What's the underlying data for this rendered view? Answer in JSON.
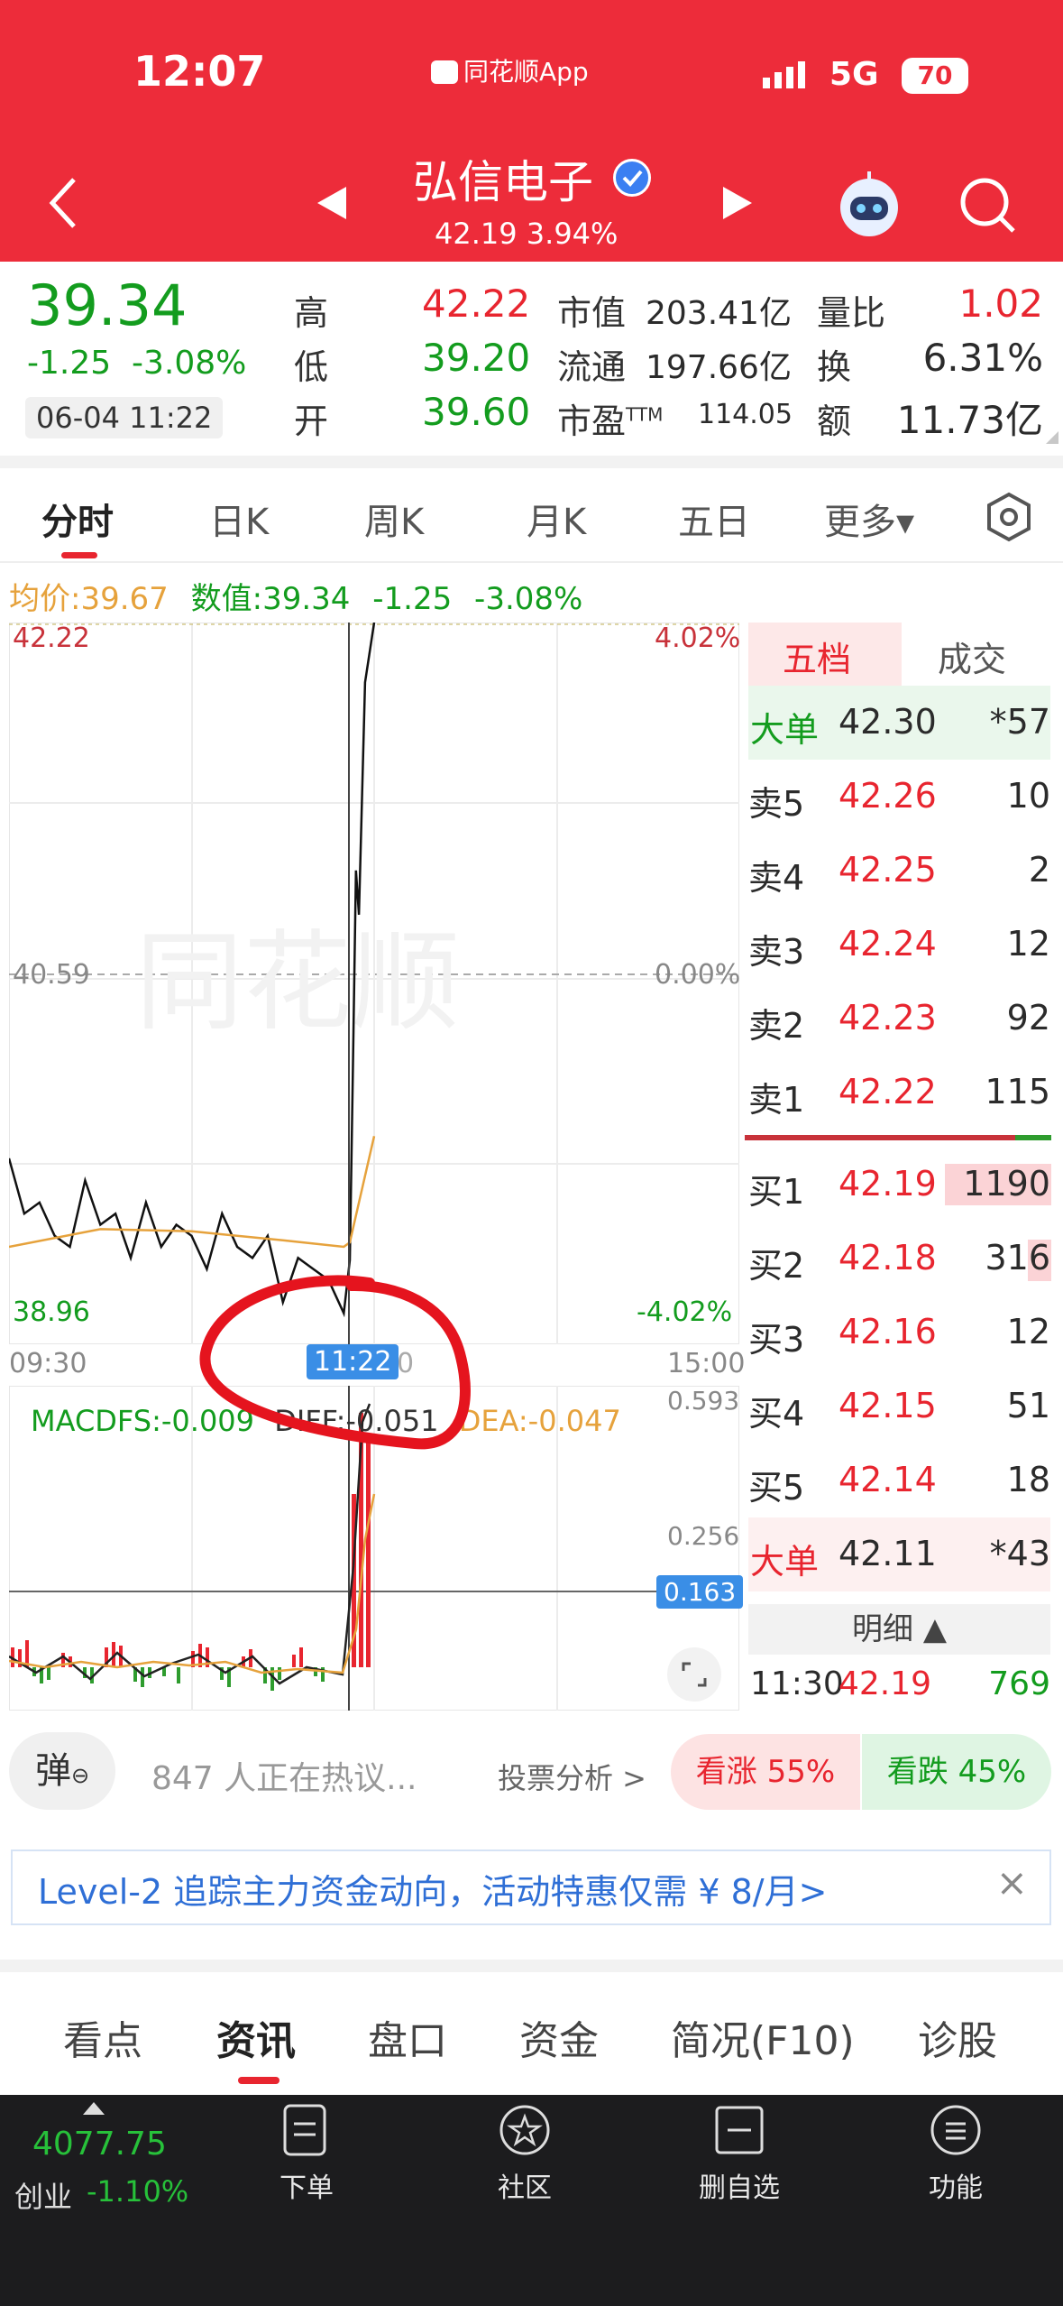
{
  "status_bar": {
    "time": "12:07",
    "app_label": "同花顺App",
    "network": "5G",
    "battery": "70"
  },
  "header": {
    "title": "弘信电子",
    "subtitle": "42.19 3.94%"
  },
  "quote": {
    "price": "39.34",
    "change": "-1.25",
    "change_pct": "-3.08%",
    "datetime": "06-04 11:22",
    "high_label": "高",
    "high": "42.22",
    "low_label": "低",
    "low": "39.20",
    "open_label": "开",
    "open": "39.60",
    "mktcap_label": "市值",
    "mktcap": "203.41亿",
    "float_label": "流通",
    "float": "197.66亿",
    "pe_label": "市盈",
    "pe_sup": "TTM",
    "pe": "114.05",
    "volratio_label": "量比",
    "volratio": "1.02",
    "turnover_label": "换",
    "turnover": "6.31%",
    "amount_label": "额",
    "amount": "11.73亿"
  },
  "chart_tabs": [
    "分时",
    "日K",
    "周K",
    "月K",
    "五日",
    "更多▾"
  ],
  "info_line": {
    "avg_label": "均价:",
    "avg": "39.67",
    "val_label": "数值:",
    "val": "39.34",
    "chg": "-1.25",
    "chg_pct": "-3.08%"
  },
  "chart_labels": {
    "y_top": "42.22",
    "y_mid": "40.59",
    "y_bot": "38.96",
    "pct_top": "4.02%",
    "pct_mid": "0.00%",
    "pct_bot": "-4.02%",
    "x_start": "09:30",
    "x_cursor": "11:22",
    "x_end": "15:00",
    "watermark": "同花顺"
  },
  "macd": {
    "macdfs": "MACDFS:-0.009",
    "diff": "DIFF:-0.051",
    "dea": "DEA:-0.047",
    "y_top": "0.593",
    "y_mid": "0.256",
    "cursor_val": "0.163"
  },
  "chart_data": {
    "type": "line",
    "title": "",
    "x_range": [
      "09:30",
      "15:00"
    ],
    "ylim": [
      38.96,
      42.22
    ],
    "series": [
      {
        "name": "价格",
        "x": [
          "09:30",
          "09:35",
          "09:40",
          "09:45",
          "09:50",
          "09:55",
          "10:00",
          "10:05",
          "10:10",
          "10:15",
          "10:20",
          "10:25",
          "10:30",
          "10:35",
          "10:40",
          "10:45",
          "10:50",
          "10:55",
          "11:00",
          "11:05",
          "11:10",
          "11:15",
          "11:20",
          "11:22",
          "11:23",
          "11:24",
          "11:25",
          "11:27",
          "11:30"
        ],
        "values": [
          39.8,
          39.55,
          39.6,
          39.45,
          39.4,
          39.7,
          39.5,
          39.55,
          39.35,
          39.6,
          39.4,
          39.5,
          39.45,
          39.3,
          39.55,
          39.4,
          39.35,
          39.45,
          39.15,
          39.35,
          39.3,
          39.25,
          39.1,
          39.34,
          40.2,
          41.1,
          40.9,
          41.95,
          42.22
        ]
      },
      {
        "name": "均价",
        "x": [
          "09:30",
          "10:00",
          "10:30",
          "11:00",
          "11:20",
          "11:22",
          "11:25",
          "11:30"
        ],
        "values": [
          39.4,
          39.48,
          39.47,
          39.43,
          39.4,
          39.42,
          39.6,
          39.9
        ]
      }
    ]
  },
  "orderbook": {
    "tab_five": "五档",
    "tab_trade": "成交",
    "big_top": {
      "label": "大单",
      "price": "42.30",
      "vol": "*57"
    },
    "asks": [
      {
        "label": "卖5",
        "price": "42.26",
        "vol": "10"
      },
      {
        "label": "卖4",
        "price": "42.25",
        "vol": "2"
      },
      {
        "label": "卖3",
        "price": "42.24",
        "vol": "12"
      },
      {
        "label": "卖2",
        "price": "42.23",
        "vol": "92"
      },
      {
        "label": "卖1",
        "price": "42.22",
        "vol": "115"
      }
    ],
    "bids": [
      {
        "label": "买1",
        "price": "42.19",
        "vol": "1190"
      },
      {
        "label": "买2",
        "price": "42.18",
        "vol": "316"
      },
      {
        "label": "买3",
        "price": "42.16",
        "vol": "12"
      },
      {
        "label": "买4",
        "price": "42.15",
        "vol": "51"
      },
      {
        "label": "买5",
        "price": "42.14",
        "vol": "18"
      }
    ],
    "big_bottom": {
      "label": "大单",
      "price": "42.11",
      "vol": "*43"
    },
    "detail_label": "明细 ▲",
    "detail_row": {
      "time": "11:30",
      "price": "42.19",
      "vol": "769"
    }
  },
  "discussion": {
    "bullet_icon_label": "弹",
    "text": "847 人正在热议...",
    "vote_link": "投票分析 >",
    "up": "看涨 55%",
    "down": "看跌 45%"
  },
  "banner": {
    "text": "Level-2 追踪主力资金动向，活动特惠仅需 ¥ 8/月>",
    "close": "×"
  },
  "bottom_tabs": [
    "看点",
    "资讯",
    "盘口",
    "资金",
    "简况(F10)",
    "诊股"
  ],
  "nav": {
    "index_value": "4077.75",
    "index_name": "创业",
    "index_change": "-1.10%",
    "order": "下单",
    "community": "社区",
    "remove_watch": "删自选",
    "functions": "功能"
  },
  "colors": {
    "header_red": "#ed2c3a",
    "up_red": "#e8252f",
    "down_green": "#139c1e",
    "avg_orange": "#e6a23c",
    "cursor_blue": "#3a8ee6",
    "nav_bg": "#1c1c1e"
  }
}
